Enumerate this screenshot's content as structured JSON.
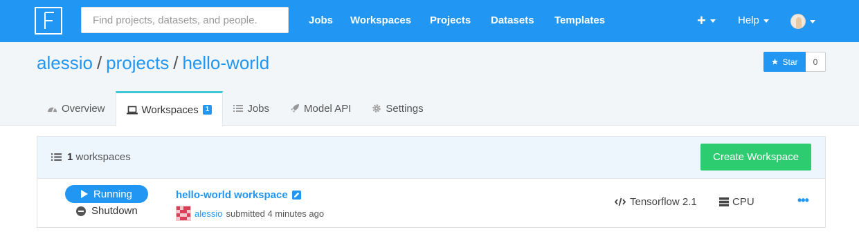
{
  "navbar": {
    "search_placeholder": "Find projects, datasets, and people.",
    "links": [
      "Jobs",
      "Workspaces",
      "Projects",
      "Datasets",
      "Templates"
    ],
    "help_label": "Help",
    "brand_color": "#2196f3"
  },
  "breadcrumb": {
    "user": "alessio",
    "section": "projects",
    "project": "hello-world",
    "separator": "/"
  },
  "star": {
    "label": "Star",
    "count": "0"
  },
  "tabs": [
    {
      "label": "Overview",
      "icon": "dashboard-icon"
    },
    {
      "label": "Workspaces",
      "icon": "laptop-icon",
      "badge": "1",
      "active": true
    },
    {
      "label": "Jobs",
      "icon": "list-icon"
    },
    {
      "label": "Model API",
      "icon": "rocket-icon"
    },
    {
      "label": "Settings",
      "icon": "gear-icon"
    }
  ],
  "panel": {
    "count": "1",
    "count_suffix": "workspaces",
    "create_label": "Create Workspace"
  },
  "workspace": {
    "status": "Running",
    "shutdown_label": "Shutdown",
    "name": "hello-world workspace",
    "user": "alessio",
    "submitted_text": "submitted 4 minutes ago",
    "environment": "Tensorflow 2.1",
    "hardware": "CPU",
    "more": "•••"
  },
  "colors": {
    "accent": "#2196f3",
    "success": "#2ecc71",
    "active_tab_border": "#3fc7d6"
  }
}
